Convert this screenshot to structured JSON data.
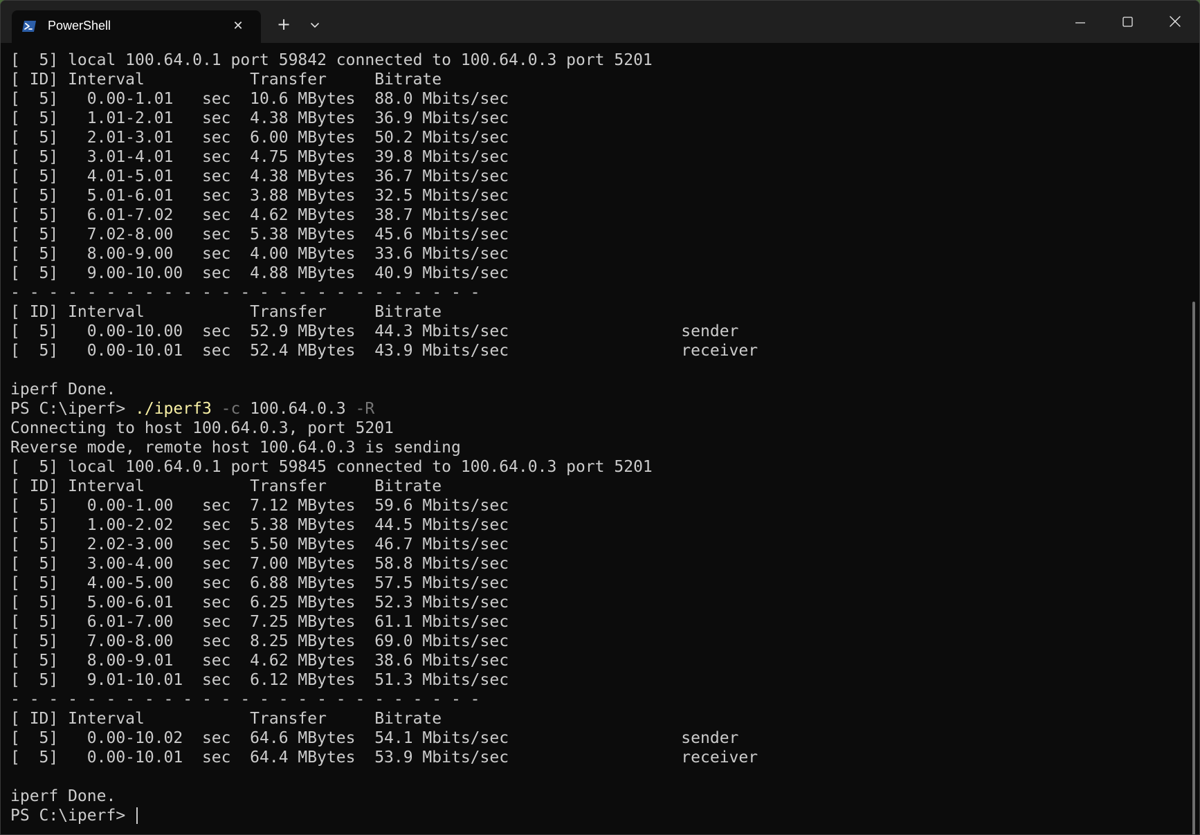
{
  "window": {
    "tab_title": "PowerShell",
    "icons": {
      "tab_icon": "powershell-icon",
      "close_tab": "close-icon",
      "new_tab": "plus-icon",
      "dropdown": "chevron-down-icon",
      "minimize": "minimize-icon",
      "maximize": "maximize-icon",
      "close_window": "close-icon"
    },
    "tab_close_glyph": "✕",
    "new_tab_glyph": "+"
  },
  "terminal": {
    "lines": [
      "[  5] local 100.64.0.1 port 59842 connected to 100.64.0.3 port 5201",
      "[ ID] Interval           Transfer     Bitrate",
      "[  5]   0.00-1.01   sec  10.6 MBytes  88.0 Mbits/sec",
      "[  5]   1.01-2.01   sec  4.38 MBytes  36.9 Mbits/sec",
      "[  5]   2.01-3.01   sec  6.00 MBytes  50.2 Mbits/sec",
      "[  5]   3.01-4.01   sec  4.75 MBytes  39.8 Mbits/sec",
      "[  5]   4.01-5.01   sec  4.38 MBytes  36.7 Mbits/sec",
      "[  5]   5.01-6.01   sec  3.88 MBytes  32.5 Mbits/sec",
      "[  5]   6.01-7.02   sec  4.62 MBytes  38.7 Mbits/sec",
      "[  5]   7.02-8.00   sec  5.38 MBytes  45.6 Mbits/sec",
      "[  5]   8.00-9.00   sec  4.00 MBytes  33.6 Mbits/sec",
      "[  5]   9.00-10.00  sec  4.88 MBytes  40.9 Mbits/sec",
      "- - - - - - - - - - - - - - - - - - - - - - - - -",
      "[ ID] Interval           Transfer     Bitrate",
      "[  5]   0.00-10.00  sec  52.9 MBytes  44.3 Mbits/sec                  sender",
      "[  5]   0.00-10.01  sec  52.4 MBytes  43.9 Mbits/sec                  receiver",
      "",
      "iperf Done.",
      "__CMD__",
      "Connecting to host 100.64.0.3, port 5201",
      "Reverse mode, remote host 100.64.0.3 is sending",
      "[  5] local 100.64.0.1 port 59845 connected to 100.64.0.3 port 5201",
      "[ ID] Interval           Transfer     Bitrate",
      "[  5]   0.00-1.00   sec  7.12 MBytes  59.6 Mbits/sec",
      "[  5]   1.00-2.02   sec  5.38 MBytes  44.5 Mbits/sec",
      "[  5]   2.02-3.00   sec  5.50 MBytes  46.7 Mbits/sec",
      "[  5]   3.00-4.00   sec  7.00 MBytes  58.8 Mbits/sec",
      "[  5]   4.00-5.00   sec  6.88 MBytes  57.5 Mbits/sec",
      "[  5]   5.00-6.01   sec  6.25 MBytes  52.3 Mbits/sec",
      "[  5]   6.01-7.00   sec  7.25 MBytes  61.1 Mbits/sec",
      "[  5]   7.00-8.00   sec  8.25 MBytes  69.0 Mbits/sec",
      "[  5]   8.00-9.01   sec  4.62 MBytes  38.6 Mbits/sec",
      "[  5]   9.01-10.01  sec  6.12 MBytes  51.3 Mbits/sec",
      "- - - - - - - - - - - - - - - - - - - - - - - - -",
      "[ ID] Interval           Transfer     Bitrate",
      "[  5]   0.00-10.02  sec  64.6 MBytes  54.1 Mbits/sec                  sender",
      "[  5]   0.00-10.01  sec  64.4 MBytes  53.9 Mbits/sec                  receiver",
      "",
      "iperf Done.",
      "__PROMPT__"
    ],
    "command_line": {
      "prompt": "PS C:\\iperf> ",
      "executable": "./iperf3",
      "flag_c": " -c",
      "host": " 100.64.0.3",
      "flag_r": " -R"
    },
    "final_prompt": "PS C:\\iperf> "
  },
  "colors": {
    "background": "#0c0c0c",
    "foreground": "#cccccc",
    "titlebar": "#202020",
    "command_highlight": "#f9f1a5",
    "argument": "#767676"
  }
}
